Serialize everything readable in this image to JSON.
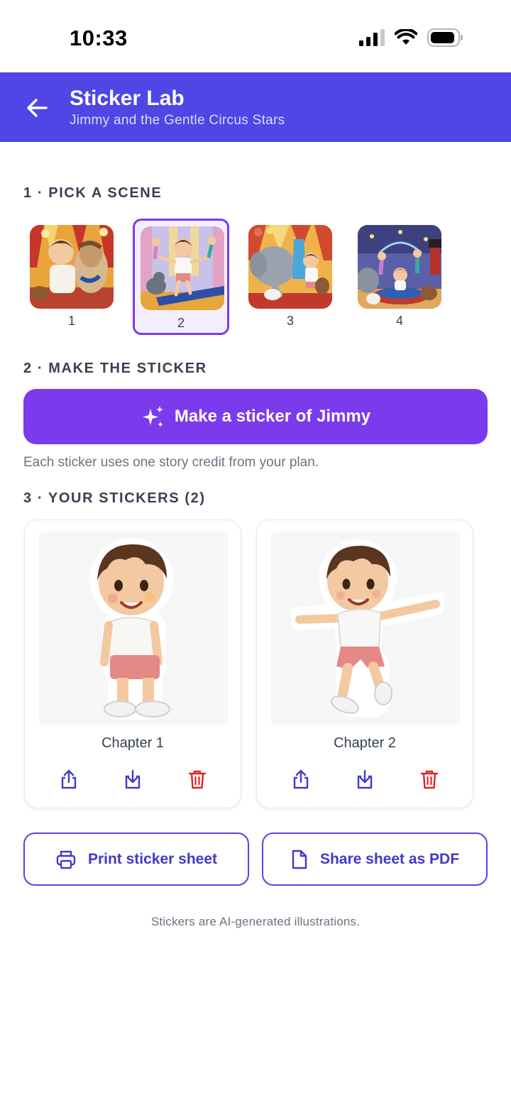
{
  "status_bar": {
    "time": "10:33"
  },
  "header": {
    "title": "Sticker Lab",
    "subtitle": "Jimmy and the Gentle Circus Stars"
  },
  "sections": {
    "pick_scene": "1 · PICK A SCENE",
    "make_sticker": "2 · MAKE THE STICKER",
    "your_stickers": "3 · YOUR STICKERS (2)"
  },
  "scenes": [
    {
      "label": "1",
      "selected": false
    },
    {
      "label": "2",
      "selected": true
    },
    {
      "label": "3",
      "selected": false
    },
    {
      "label": "4",
      "selected": false
    }
  ],
  "make_button": {
    "label": "Make a sticker of Jimmy",
    "icon": "sparkles-icon"
  },
  "credit_note": "Each sticker uses one story credit from your plan.",
  "stickers": [
    {
      "caption": "Chapter 1"
    },
    {
      "caption": "Chapter 2"
    }
  ],
  "actions": {
    "print_label": "Print sticker sheet",
    "share_pdf_label": "Share sheet as PDF"
  },
  "footer_note": "Stickers are AI-generated illustrations.",
  "colors": {
    "header": "#4f46e5",
    "primary_button": "#7c3aed",
    "delete": "#dc2626",
    "icon": "#4338ca"
  }
}
